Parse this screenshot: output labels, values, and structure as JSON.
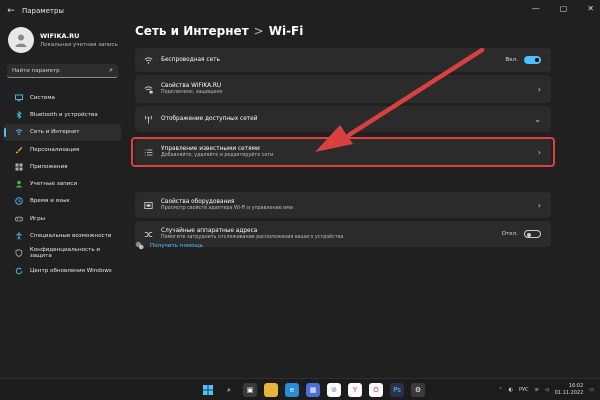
{
  "window": {
    "title": "Параметры"
  },
  "profile": {
    "name": "WIFIKA.RU",
    "account_type": "Локальная учетная запись"
  },
  "search": {
    "placeholder": "Найти параметр"
  },
  "sidebar": {
    "items": [
      {
        "label": "Система",
        "icon": "monitor-icon",
        "color": "#4cc2ff"
      },
      {
        "label": "Bluetooth и устройства",
        "icon": "bluetooth-icon",
        "color": "#4cc2ff"
      },
      {
        "label": "Сеть и Интернет",
        "icon": "network-icon",
        "color": "#4cc2ff",
        "active": true
      },
      {
        "label": "Персонализация",
        "icon": "brush-icon",
        "color": "#f2a24a"
      },
      {
        "label": "Приложения",
        "icon": "apps-icon",
        "color": "#b0b0b0"
      },
      {
        "label": "Учетные записи",
        "icon": "person-icon",
        "color": "#3fb950"
      },
      {
        "label": "Время и язык",
        "icon": "globe-clock-icon",
        "color": "#4cc2ff"
      },
      {
        "label": "Игры",
        "icon": "gamepad-icon",
        "color": "#b0b0b0"
      },
      {
        "label": "Специальные возможности",
        "icon": "accessibility-icon",
        "color": "#4cc2ff"
      },
      {
        "label": "Конфиденциальность и защита",
        "icon": "shield-icon",
        "color": "#b0b0b0"
      },
      {
        "label": "Центр обновления Windows",
        "icon": "update-icon",
        "color": "#4cc2ff"
      }
    ]
  },
  "breadcrumb": {
    "parent": "Сеть и Интернет",
    "separator": ">",
    "current": "Wi-Fi"
  },
  "settings": {
    "wireless": {
      "label": "Беспроводная сеть",
      "toggle_label": "Вкл."
    },
    "properties": {
      "label": "Свойства WiFIKA.RU",
      "sub": "Подключено, защищено"
    },
    "available": {
      "label": "Отображение доступных сетей"
    },
    "known": {
      "label": "Управление известными сетями",
      "sub": "Добавляйте, удаляйте и редактируйте сети"
    },
    "hardware": {
      "label": "Свойства оборудования",
      "sub": "Просмотр свойств адаптера Wi-Fi и управление ими"
    },
    "random_mac": {
      "label": "Случайные аппаратные адреса",
      "sub": "Помогите затруднить отслеживание расположения вашего устройства",
      "toggle_label": "Откл."
    }
  },
  "help": {
    "label": "Получить помощь"
  },
  "taskbar": {
    "lang": "РУС",
    "time": "16:02",
    "date": "01.11.2022"
  },
  "colors": {
    "accent": "#4cc2ff",
    "highlight": "#e04040"
  }
}
